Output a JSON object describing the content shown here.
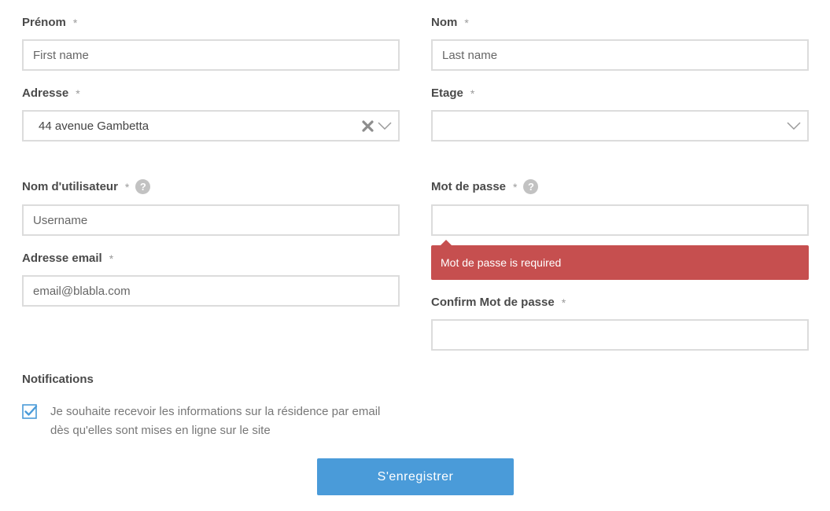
{
  "form": {
    "first_name": {
      "label": "Prénom",
      "required_mark": "*",
      "placeholder": "First name",
      "value": ""
    },
    "last_name": {
      "label": "Nom",
      "required_mark": "*",
      "placeholder": "Last name",
      "value": ""
    },
    "address": {
      "label": "Adresse",
      "required_mark": "*",
      "value": "44 avenue Gambetta",
      "clear_icon": "close-icon",
      "dropdown_icon": "chevron-down-icon"
    },
    "floor": {
      "label": "Etage",
      "required_mark": "*",
      "value": "",
      "dropdown_icon": "chevron-down-icon"
    },
    "username": {
      "label": "Nom d'utilisateur",
      "required_mark": "*",
      "placeholder": "Username",
      "help_icon": "?"
    },
    "password": {
      "label": "Mot de passe",
      "required_mark": "*",
      "help_icon": "?",
      "error": "Mot de passe is required"
    },
    "email": {
      "label": "Adresse email",
      "required_mark": "*",
      "placeholder": "email@blabla.com"
    },
    "confirm_password": {
      "label": "Confirm Mot de passe",
      "required_mark": "*"
    },
    "notifications": {
      "title": "Notifications",
      "checkbox_checked": true,
      "checkbox_text": "Je souhaite recevoir les informations sur la résidence par email dès qu'elles sont mises en ligne sur le site"
    },
    "submit_label": "S'enregistrer"
  },
  "colors": {
    "accent": "#4a9bd9",
    "error": "#c64f4f",
    "border": "#dcdcdc",
    "help_icon": "#c2c2c2"
  }
}
